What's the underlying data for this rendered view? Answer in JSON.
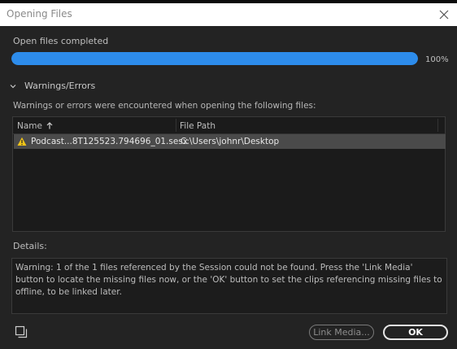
{
  "window": {
    "title": "Opening Files",
    "close_icon": "close-icon"
  },
  "progress": {
    "label": "Open files completed",
    "value": 100,
    "percent_text": "100%",
    "color": "#2d8ceb"
  },
  "warnings": {
    "section_title": "Warnings/Errors",
    "message": "Warnings or errors were encountered when opening the following files:",
    "columns": {
      "name": "Name",
      "path": "File Path"
    },
    "rows": [
      {
        "name": "Podcast...8T125523.794696_01.sesx",
        "path": "C:\\Users\\johnr\\Desktop",
        "icon": "warning-icon"
      }
    ]
  },
  "details": {
    "label": "Details:",
    "text": "Warning: 1 of the 1 files referenced by the Session could not be found. Press the 'Link Media' button to locate the missing files now, or the 'OK' button to set the clips referencing missing files to offline, to be linked later."
  },
  "footer": {
    "link_media_label": "Link Media...",
    "ok_label": "OK"
  }
}
